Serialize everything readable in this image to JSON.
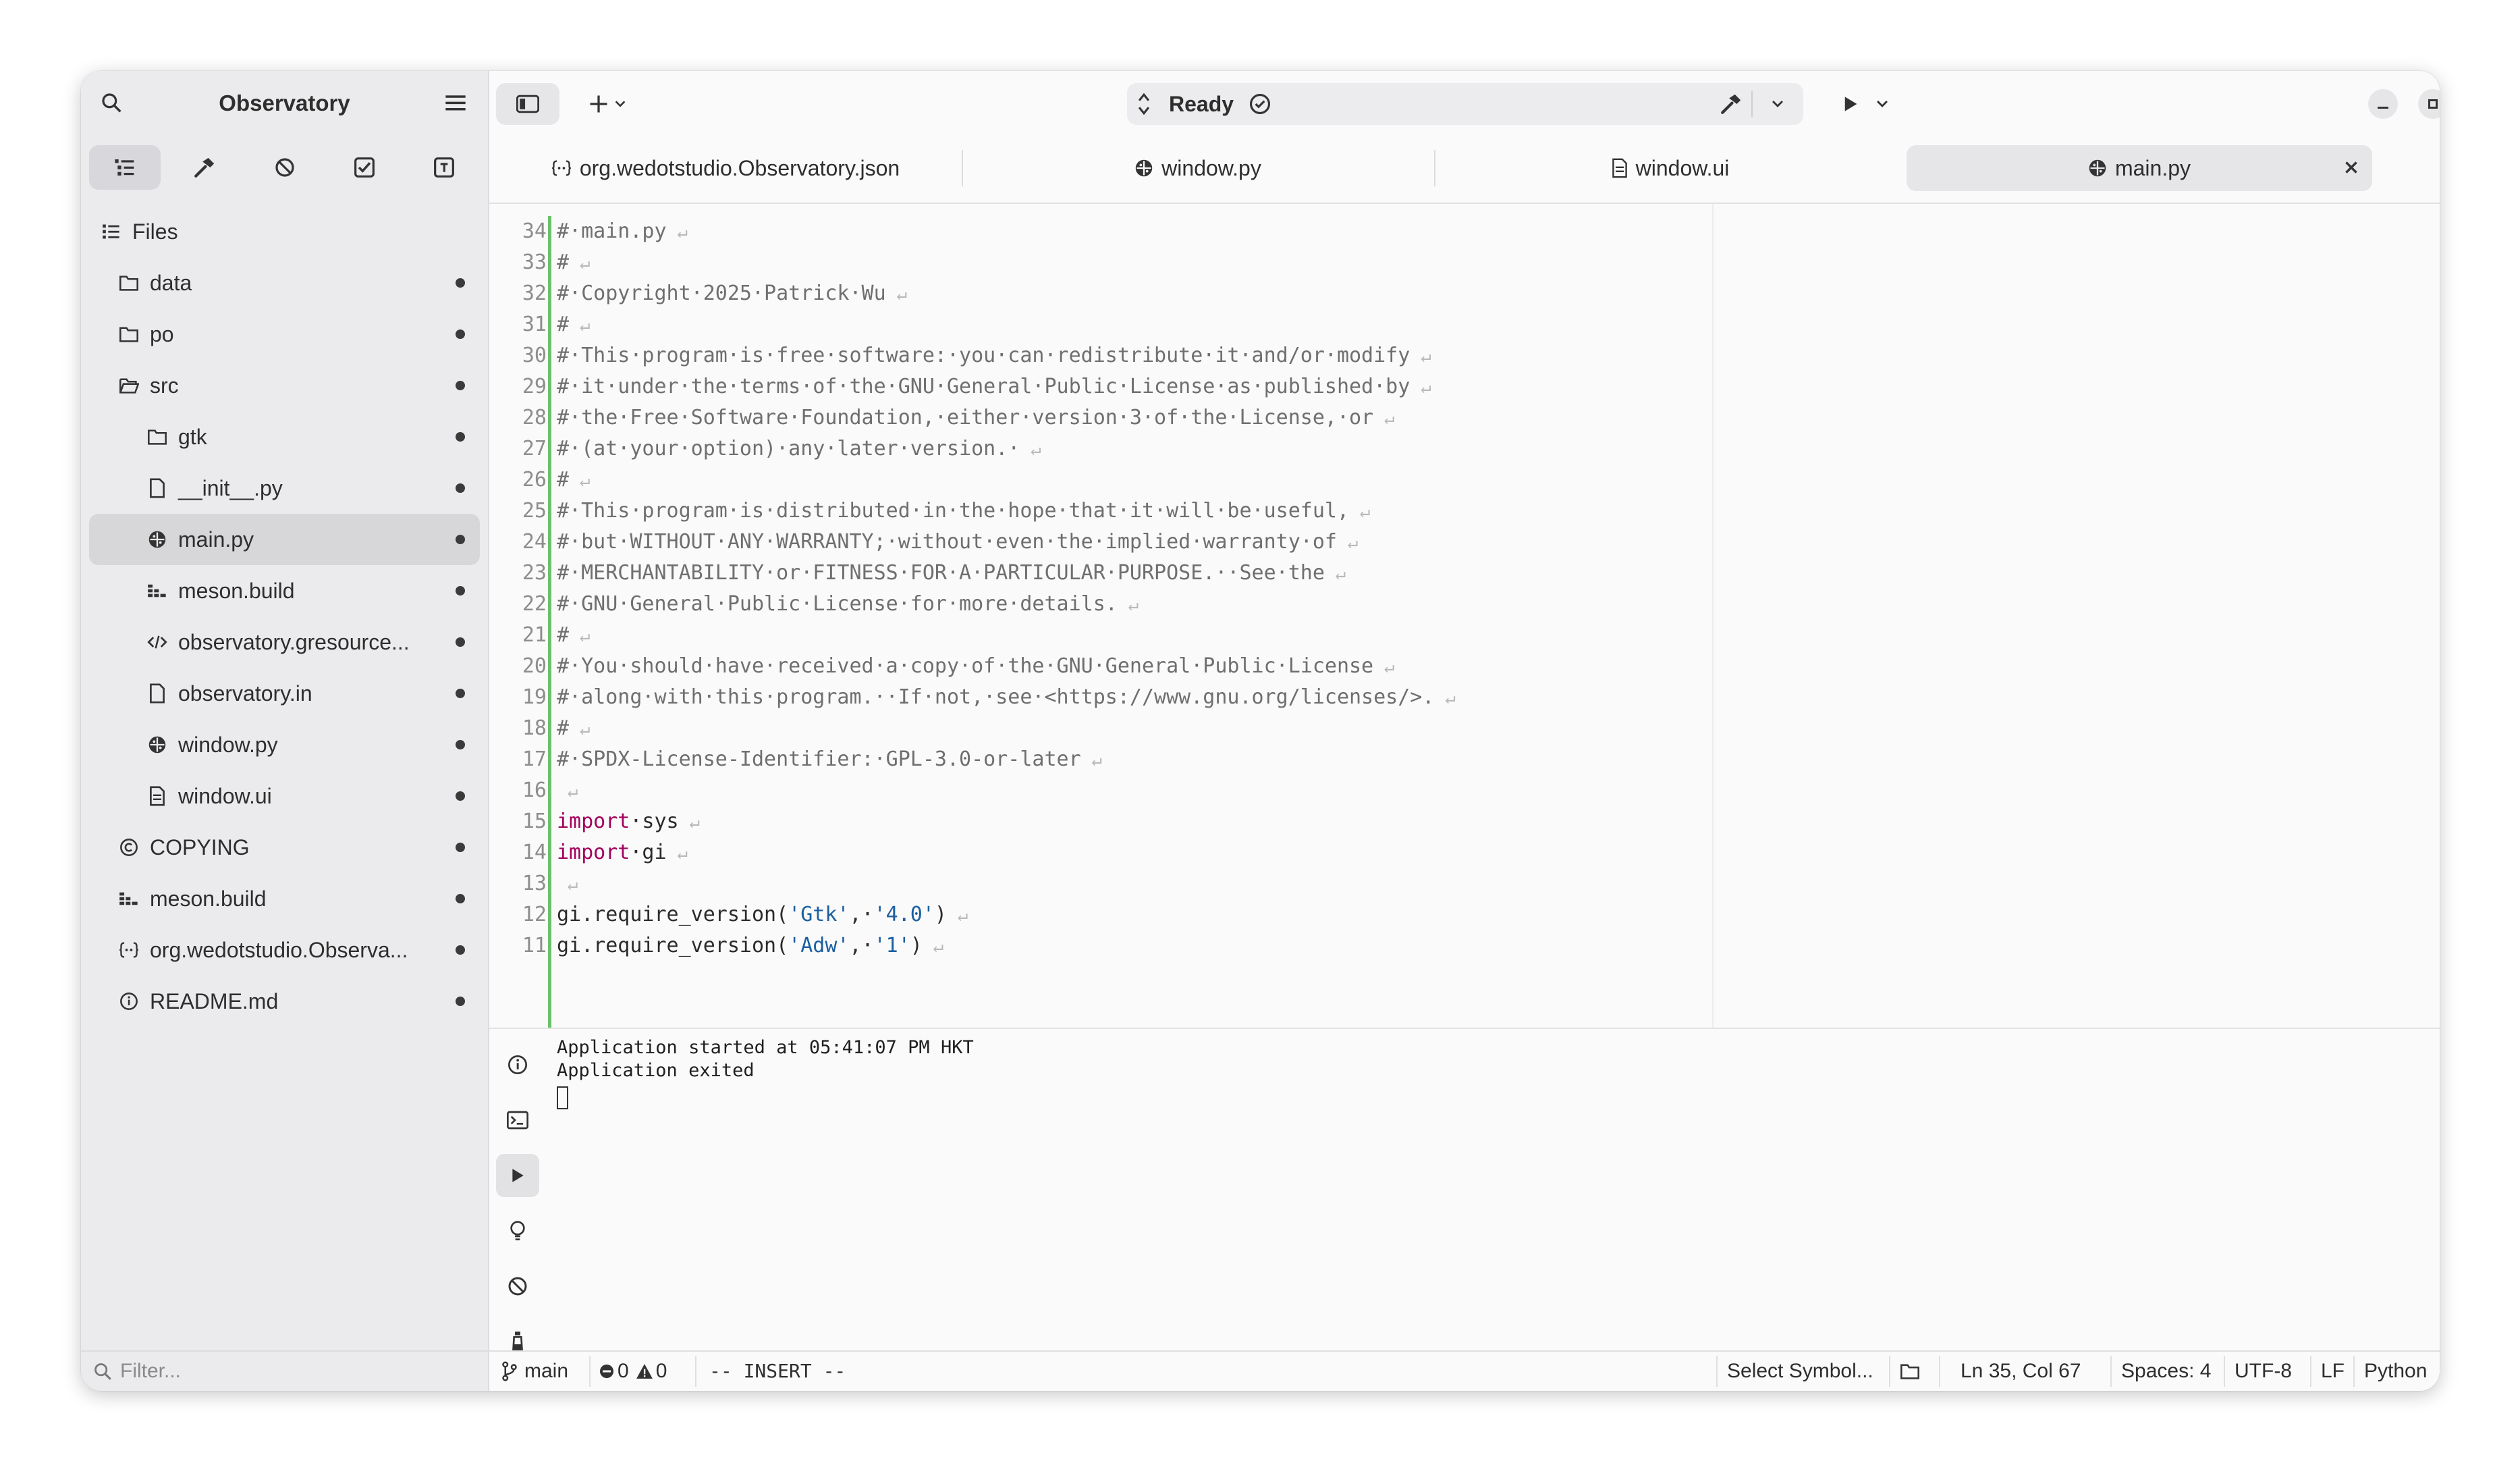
{
  "sidebar": {
    "title": "Observatory",
    "filter_placeholder": "Filter...",
    "files_header": "Files",
    "items": [
      {
        "label": "data",
        "icon": "folder-icon",
        "indent": 0
      },
      {
        "label": "po",
        "icon": "folder-icon",
        "indent": 0
      },
      {
        "label": "src",
        "icon": "folder-open-icon",
        "indent": 0
      },
      {
        "label": "gtk",
        "icon": "folder-icon",
        "indent": 1
      },
      {
        "label": "__init__.py",
        "icon": "file-icon",
        "indent": 1
      },
      {
        "label": "main.py",
        "icon": "python-icon",
        "indent": 1,
        "selected": true
      },
      {
        "label": "meson.build",
        "icon": "build-icon",
        "indent": 1
      },
      {
        "label": "observatory.gresource...",
        "icon": "code-icon",
        "indent": 1
      },
      {
        "label": "observatory.in",
        "icon": "file-icon",
        "indent": 1
      },
      {
        "label": "window.py",
        "icon": "python-icon",
        "indent": 1
      },
      {
        "label": "window.ui",
        "icon": "ui-file-icon",
        "indent": 1
      },
      {
        "label": "COPYING",
        "icon": "copyright-icon",
        "indent": 0
      },
      {
        "label": "meson.build",
        "icon": "build-icon",
        "indent": 0
      },
      {
        "label": "org.wedotstudio.Observa...",
        "icon": "json-icon",
        "indent": 0
      },
      {
        "label": "README.md",
        "icon": "info-icon",
        "indent": 0
      }
    ]
  },
  "toolbar": {
    "status": "Ready"
  },
  "tabs": [
    {
      "label": "org.wedotstudio.Observatory.json",
      "icon": "json-icon"
    },
    {
      "label": "window.py",
      "icon": "python-icon"
    },
    {
      "label": "window.ui",
      "icon": "ui-file-icon"
    },
    {
      "label": "main.py",
      "icon": "python-icon",
      "active": true
    }
  ],
  "editor": {
    "lines": [
      {
        "n": "34",
        "text": "#·main.py",
        "type": "comment"
      },
      {
        "n": "33",
        "text": "#",
        "type": "comment"
      },
      {
        "n": "32",
        "text": "#·Copyright·2025·Patrick·Wu",
        "type": "comment"
      },
      {
        "n": "31",
        "text": "#",
        "type": "comment"
      },
      {
        "n": "30",
        "text": "#·This·program·is·free·software:·you·can·redistribute·it·and/or·modify",
        "type": "comment"
      },
      {
        "n": "29",
        "text": "#·it·under·the·terms·of·the·GNU·General·Public·License·as·published·by",
        "type": "comment"
      },
      {
        "n": "28",
        "text": "#·the·Free·Software·Foundation,·either·version·3·of·the·License,·or",
        "type": "comment"
      },
      {
        "n": "27",
        "text": "#·(at·your·option)·any·later·version.·",
        "type": "comment"
      },
      {
        "n": "26",
        "text": "#",
        "type": "comment"
      },
      {
        "n": "25",
        "text": "#·This·program·is·distributed·in·the·hope·that·it·will·be·useful,",
        "type": "comment"
      },
      {
        "n": "24",
        "text": "#·but·WITHOUT·ANY·WARRANTY;·without·even·the·implied·warranty·of",
        "type": "comment"
      },
      {
        "n": "23",
        "text": "#·MERCHANTABILITY·or·FITNESS·FOR·A·PARTICULAR·PURPOSE.··See·the",
        "type": "comment"
      },
      {
        "n": "22",
        "text": "#·GNU·General·Public·License·for·more·details.",
        "type": "comment"
      },
      {
        "n": "21",
        "text": "#",
        "type": "comment"
      },
      {
        "n": "20",
        "text": "#·You·should·have·received·a·copy·of·the·GNU·General·Public·License",
        "type": "comment"
      },
      {
        "n": "19",
        "text": "#·along·with·this·program.··If·not,·see·<https://www.gnu.org/licenses/>.",
        "type": "comment"
      },
      {
        "n": "18",
        "text": "#",
        "type": "comment"
      },
      {
        "n": "17",
        "text": "#·SPDX-License-Identifier:·GPL-3.0-or-later",
        "type": "comment"
      },
      {
        "n": "16",
        "text": "",
        "type": "plain"
      },
      {
        "n": "15",
        "kw": "import",
        "rest": "·sys",
        "type": "import"
      },
      {
        "n": "14",
        "kw": "import",
        "rest": "·gi",
        "type": "import"
      },
      {
        "n": "13",
        "text": "",
        "type": "plain"
      },
      {
        "n": "12",
        "pre": "gi.require_version(",
        "s1": "'Gtk'",
        "mid": ",·",
        "s2": "'4.0'",
        "post": ")",
        "type": "call"
      },
      {
        "n": "11",
        "pre": "gi.require_version(",
        "s1": "'Adw'",
        "mid": ",·",
        "s2": "'1'",
        "post": ")",
        "type": "call"
      }
    ]
  },
  "console": {
    "lines": [
      "Application started at 05:41:07 PM HKT",
      "Application exited"
    ]
  },
  "statusbar": {
    "branch": "main",
    "errors": "0",
    "warnings": "0",
    "mode": "-- INSERT --",
    "symbol": "Select Symbol...",
    "position": "Ln 35, Col 67",
    "spaces": "Spaces: 4",
    "encoding": "UTF-8",
    "line_ending": "LF",
    "language": "Python"
  },
  "colors": {
    "accent_change": "#6cc06a",
    "keyword": "#a2005d",
    "string": "#1a5fa0",
    "comment": "#6f6f6f"
  }
}
